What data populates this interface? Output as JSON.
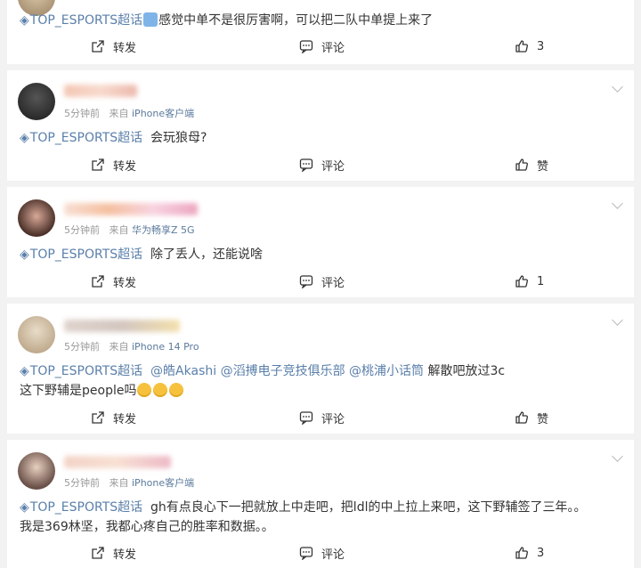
{
  "tag_text": "TOP_ESPORTS超话",
  "labels": {
    "forward": "转发",
    "comment": "评论",
    "like": "赞"
  },
  "posts": [
    {
      "content": "感觉中单不是很厉害啊，可以把二队中单提上来了",
      "likes": "3"
    },
    {
      "time": "5分钟前",
      "source_prefix": "来自",
      "source": "iPhone客户端",
      "content": "会玩狼母?",
      "likes": "赞"
    },
    {
      "time": "5分钟前",
      "source_prefix": "来自",
      "source": "华为畅享Z 5G",
      "content": "除了丢人，还能说啥",
      "likes": "1"
    },
    {
      "time": "5分钟前",
      "source_prefix": "来自",
      "source": "iPhone 14 Pro",
      "mentions": [
        "@皓Akashi",
        "@滔搏电子竞技俱乐部",
        "@桃浦小话筒"
      ],
      "content": "解散吧放过3c",
      "content_line2": "这下野辅是people吗",
      "likes": "赞"
    },
    {
      "time": "5分钟前",
      "source_prefix": "来自",
      "source": "iPhone客户端",
      "content": "gh有点良心下一把就放上中走吧，把ldl的中上拉上来吧，这下野辅签了三年。。",
      "content_line2": "我是369林坚，我都心疼自己的胜率和数据。。",
      "likes": "3"
    }
  ]
}
